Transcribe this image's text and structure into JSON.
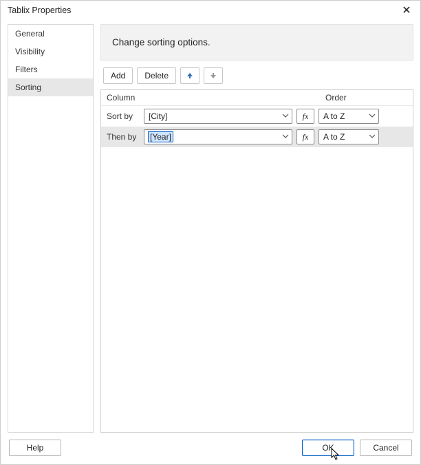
{
  "title": "Tablix Properties",
  "nav": {
    "items": [
      {
        "label": "General"
      },
      {
        "label": "Visibility"
      },
      {
        "label": "Filters"
      },
      {
        "label": "Sorting"
      }
    ],
    "selected_index": 3
  },
  "panel": {
    "heading": "Change sorting options."
  },
  "toolbar": {
    "add": "Add",
    "delete": "Delete"
  },
  "grid": {
    "columns": {
      "column": "Column",
      "order": "Order"
    },
    "rows": [
      {
        "label": "Sort by",
        "column": "[City]",
        "order": "A to Z",
        "fx": "fx",
        "selected": false,
        "focus": false
      },
      {
        "label": "Then by",
        "column": "[Year]",
        "order": "A to Z",
        "fx": "fx",
        "selected": true,
        "focus": true
      }
    ]
  },
  "buttons": {
    "help": "Help",
    "ok": "OK",
    "cancel": "Cancel"
  }
}
